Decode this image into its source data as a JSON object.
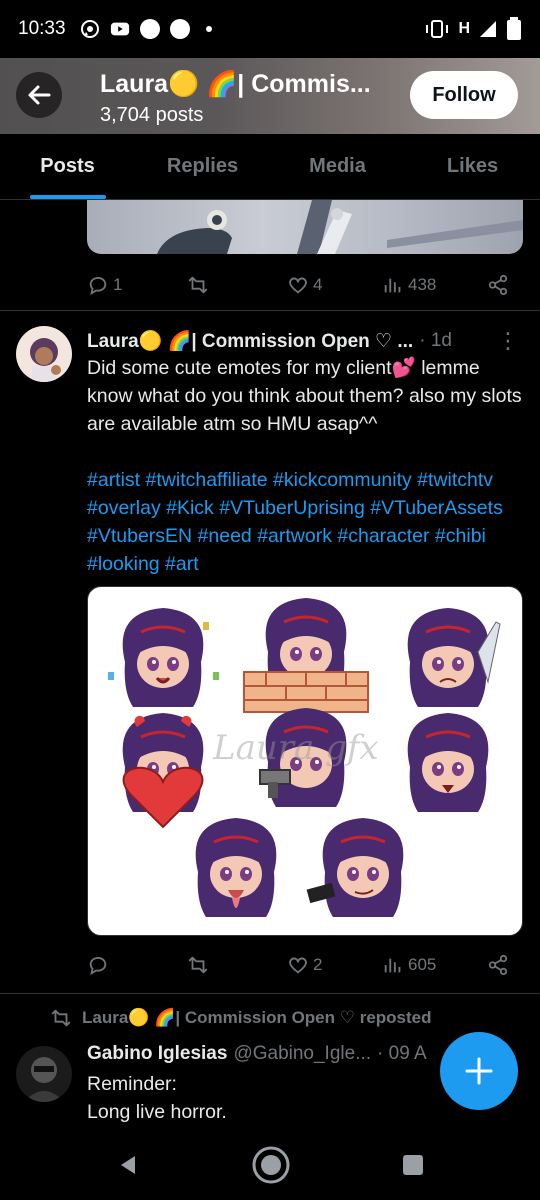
{
  "status_bar": {
    "time": "10:33",
    "icons": [
      "whatsapp-icon",
      "youtube-icon",
      "circle-icon",
      "circle-icon",
      "dot-icon"
    ],
    "right_text": "H",
    "battery": "26"
  },
  "header": {
    "title": "Laura🟡 🌈| Commis...",
    "posts_count": "3,704 posts",
    "follow_label": "Follow"
  },
  "tabs": [
    {
      "label": "Posts",
      "active": true
    },
    {
      "label": "Replies",
      "active": false
    },
    {
      "label": "Media",
      "active": false
    },
    {
      "label": "Likes",
      "active": false
    }
  ],
  "prev_post": {
    "replies": "1",
    "likes": "4",
    "views": "438"
  },
  "tweet": {
    "name": "Laura🟡 🌈| Commission Open ♡ ...",
    "time": "· 1d",
    "text": "Did some cute emotes for my client💕 lemme know what do you think about them? also my slots are available atm so HMU asap^^",
    "hashtags": "#artist #twitchaffiliate #kickcommunity #twitchtv #overlay #Kick #VTuberUprising #VTuberAssets #VtubersEN #need #artwork #character #chibi #looking #art",
    "watermark": "Laura gfx",
    "replies": "",
    "likes": "2",
    "views": "605"
  },
  "repost": {
    "label": "Laura🟡 🌈| Commission Open ♡ reposted",
    "name": "Gabino Iglesias",
    "handle": "@Gabino_Igle...",
    "time": "· 09 A",
    "line1": "Reminder:",
    "line2": "Long live horror."
  },
  "colors": {
    "accent": "#1d9bf0",
    "muted": "#71767b",
    "text": "#e7e9ea",
    "background": "#000000"
  }
}
